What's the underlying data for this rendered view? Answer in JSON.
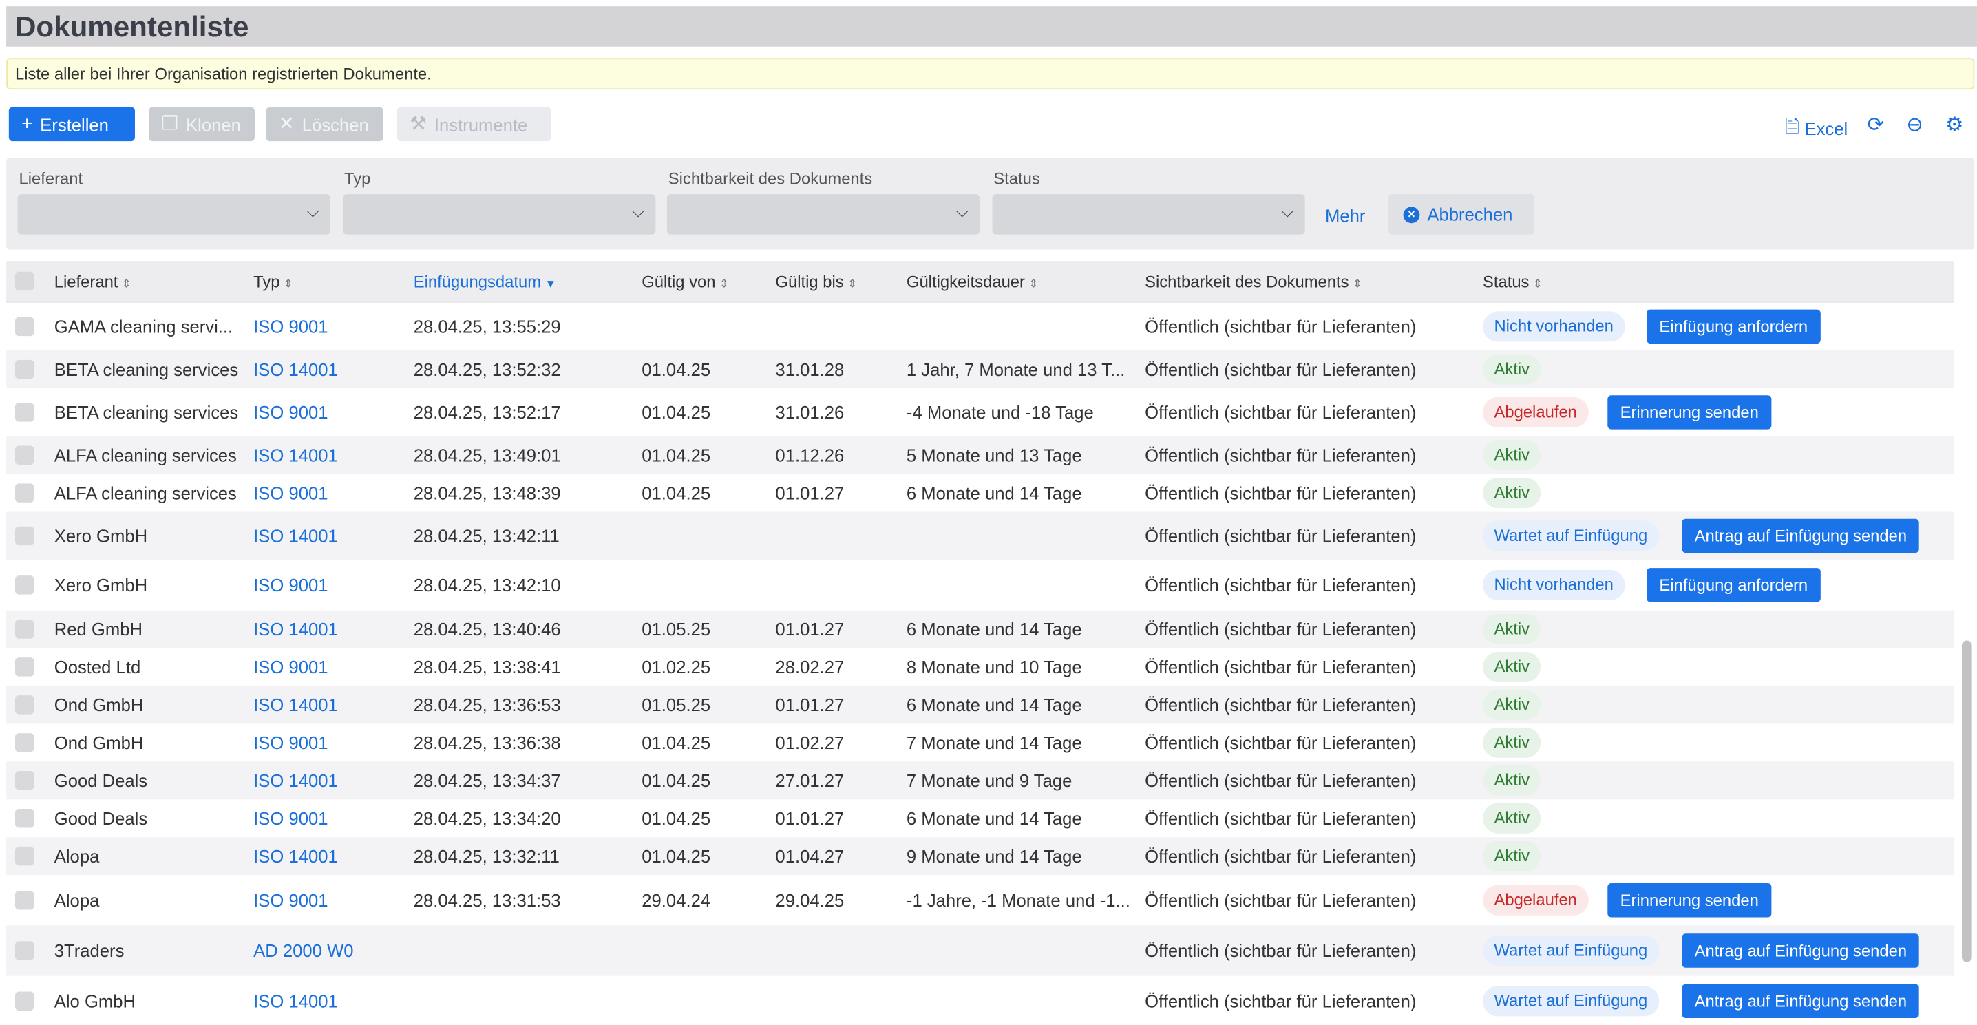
{
  "page_title": "Dokumentenliste",
  "info_text": "Liste aller bei Ihrer Organisation registrierten Dokumente.",
  "toolbar": {
    "create": "Erstellen",
    "clone": "Klonen",
    "delete": "Löschen",
    "tools": "Instrumente",
    "excel": "Excel"
  },
  "filters": {
    "supplier_label": "Lieferant",
    "type_label": "Typ",
    "visibility_label": "Sichtbarkeit des Dokuments",
    "status_label": "Status",
    "more": "Mehr",
    "cancel": "Abbrechen"
  },
  "columns": {
    "supplier": "Lieferant",
    "type": "Typ",
    "inserted": "Einfügungsdatum",
    "valid_from": "Gültig von",
    "valid_to": "Gültig bis",
    "duration": "Gültigkeitsdauer",
    "visibility": "Sichtbarkeit des Dokuments",
    "status": "Status"
  },
  "colors": {
    "accent": "#1a73e8",
    "active": "#2e7d32",
    "expired": "#c62828"
  },
  "rows": [
    {
      "supplier": "GAMA cleaning servi...",
      "type": "ISO 9001",
      "inserted": "28.04.25, 13:55:29",
      "valid_from": "",
      "valid_to": "",
      "duration": "",
      "visibility": "Öffentlich (sichtbar für Lieferanten)",
      "status": "Nicht vorhanden",
      "status_color": "blue",
      "action": "Einfügung anfordern"
    },
    {
      "supplier": "BETA cleaning services",
      "type": "ISO 14001",
      "inserted": "28.04.25, 13:52:32",
      "valid_from": "01.04.25",
      "valid_to": "31.01.28",
      "duration": "1 Jahr, 7 Monate und 13 T...",
      "visibility": "Öffentlich (sichtbar für Lieferanten)",
      "status": "Aktiv",
      "status_color": "green",
      "action": ""
    },
    {
      "supplier": "BETA cleaning services",
      "type": "ISO 9001",
      "inserted": "28.04.25, 13:52:17",
      "valid_from": "01.04.25",
      "valid_to": "31.01.26",
      "duration": "-4 Monate und -18 Tage",
      "visibility": "Öffentlich (sichtbar für Lieferanten)",
      "status": "Abgelaufen",
      "status_color": "red",
      "action": "Erinnerung senden"
    },
    {
      "supplier": "ALFA cleaning services",
      "type": "ISO 14001",
      "inserted": "28.04.25, 13:49:01",
      "valid_from": "01.04.25",
      "valid_to": "01.12.26",
      "duration": "5 Monate und 13 Tage",
      "visibility": "Öffentlich (sichtbar für Lieferanten)",
      "status": "Aktiv",
      "status_color": "green",
      "action": ""
    },
    {
      "supplier": "ALFA cleaning services",
      "type": "ISO 9001",
      "inserted": "28.04.25, 13:48:39",
      "valid_from": "01.04.25",
      "valid_to": "01.01.27",
      "duration": "6 Monate und 14 Tage",
      "visibility": "Öffentlich (sichtbar für Lieferanten)",
      "status": "Aktiv",
      "status_color": "green",
      "action": ""
    },
    {
      "supplier": "Xero GmbH",
      "type": "ISO 14001",
      "inserted": "28.04.25, 13:42:11",
      "valid_from": "",
      "valid_to": "",
      "duration": "",
      "visibility": "Öffentlich (sichtbar für Lieferanten)",
      "status": "Wartet auf Einfügung",
      "status_color": "blue",
      "action": "Antrag auf Einfügung senden"
    },
    {
      "supplier": "Xero GmbH",
      "type": "ISO 9001",
      "inserted": "28.04.25, 13:42:10",
      "valid_from": "",
      "valid_to": "",
      "duration": "",
      "visibility": "Öffentlich (sichtbar für Lieferanten)",
      "status": "Nicht vorhanden",
      "status_color": "blue",
      "action": "Einfügung anfordern"
    },
    {
      "supplier": "Red GmbH",
      "type": "ISO 14001",
      "inserted": "28.04.25, 13:40:46",
      "valid_from": "01.05.25",
      "valid_to": "01.01.27",
      "duration": "6 Monate und 14 Tage",
      "visibility": "Öffentlich (sichtbar für Lieferanten)",
      "status": "Aktiv",
      "status_color": "green",
      "action": ""
    },
    {
      "supplier": "Oosted Ltd",
      "type": "ISO 9001",
      "inserted": "28.04.25, 13:38:41",
      "valid_from": "01.02.25",
      "valid_to": "28.02.27",
      "duration": "8 Monate und 10 Tage",
      "visibility": "Öffentlich (sichtbar für Lieferanten)",
      "status": "Aktiv",
      "status_color": "green",
      "action": ""
    },
    {
      "supplier": "Ond GmbH",
      "type": "ISO 14001",
      "inserted": "28.04.25, 13:36:53",
      "valid_from": "01.05.25",
      "valid_to": "01.01.27",
      "duration": "6 Monate und 14 Tage",
      "visibility": "Öffentlich (sichtbar für Lieferanten)",
      "status": "Aktiv",
      "status_color": "green",
      "action": ""
    },
    {
      "supplier": "Ond GmbH",
      "type": "ISO 9001",
      "inserted": "28.04.25, 13:36:38",
      "valid_from": "01.04.25",
      "valid_to": "01.02.27",
      "duration": "7 Monate und 14 Tage",
      "visibility": "Öffentlich (sichtbar für Lieferanten)",
      "status": "Aktiv",
      "status_color": "green",
      "action": ""
    },
    {
      "supplier": "Good Deals",
      "type": "ISO 14001",
      "inserted": "28.04.25, 13:34:37",
      "valid_from": "01.04.25",
      "valid_to": "27.01.27",
      "duration": "7 Monate und 9 Tage",
      "visibility": "Öffentlich (sichtbar für Lieferanten)",
      "status": "Aktiv",
      "status_color": "green",
      "action": ""
    },
    {
      "supplier": "Good Deals",
      "type": "ISO 9001",
      "inserted": "28.04.25, 13:34:20",
      "valid_from": "01.04.25",
      "valid_to": "01.01.27",
      "duration": "6 Monate und 14 Tage",
      "visibility": "Öffentlich (sichtbar für Lieferanten)",
      "status": "Aktiv",
      "status_color": "green",
      "action": ""
    },
    {
      "supplier": "Alopa",
      "type": "ISO 14001",
      "inserted": "28.04.25, 13:32:11",
      "valid_from": "01.04.25",
      "valid_to": "01.04.27",
      "duration": "9 Monate und 14 Tage",
      "visibility": "Öffentlich (sichtbar für Lieferanten)",
      "status": "Aktiv",
      "status_color": "green",
      "action": ""
    },
    {
      "supplier": "Alopa",
      "type": "ISO 9001",
      "inserted": "28.04.25, 13:31:53",
      "valid_from": "29.04.24",
      "valid_to": "29.04.25",
      "duration": "-1 Jahre, -1 Monate und -1...",
      "visibility": "Öffentlich (sichtbar für Lieferanten)",
      "status": "Abgelaufen",
      "status_color": "red",
      "action": "Erinnerung senden"
    },
    {
      "supplier": "3Traders",
      "type": "AD 2000 W0",
      "inserted": "",
      "valid_from": "",
      "valid_to": "",
      "duration": "",
      "visibility": "Öffentlich (sichtbar für Lieferanten)",
      "status": "Wartet auf Einfügung",
      "status_color": "blue",
      "action": "Antrag auf Einfügung senden"
    },
    {
      "supplier": "Alo GmbH",
      "type": "ISO 14001",
      "inserted": "",
      "valid_from": "",
      "valid_to": "",
      "duration": "",
      "visibility": "Öffentlich (sichtbar für Lieferanten)",
      "status": "Wartet auf Einfügung",
      "status_color": "blue",
      "action": "Antrag auf Einfügung senden"
    }
  ]
}
